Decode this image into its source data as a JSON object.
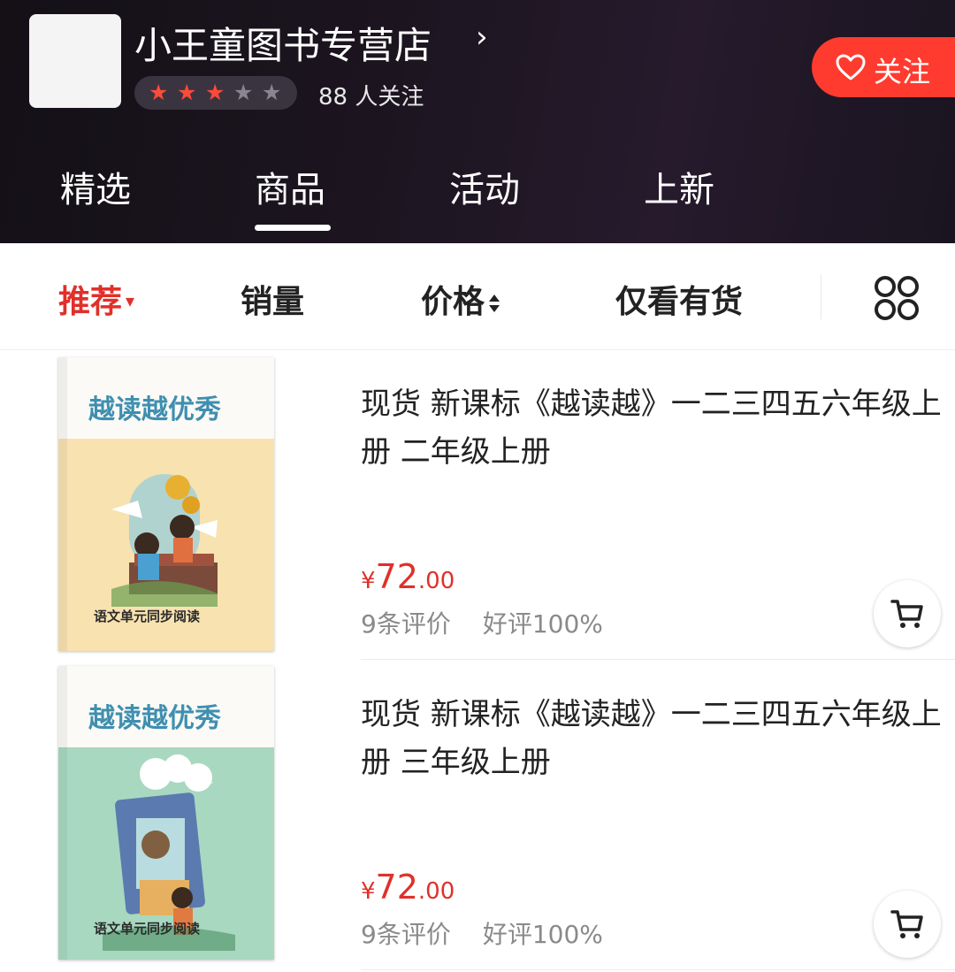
{
  "shop": {
    "name": "小王童图书专营店",
    "arrow": "›",
    "rating_stars_filled": 3,
    "rating_stars_total": 5,
    "followers": "88 人关注",
    "follow_label": "关注",
    "logo_icon": "shop-logo"
  },
  "tabs": [
    {
      "label": "精选",
      "active": false
    },
    {
      "label": "商品",
      "active": true
    },
    {
      "label": "活动",
      "active": false
    },
    {
      "label": "上新",
      "active": false
    }
  ],
  "sort": {
    "recommend": "推荐",
    "sales": "销量",
    "price": "价格",
    "in_stock": "仅看有货",
    "layout_icon": "grid-layout-icon"
  },
  "colors": {
    "accent": "#e0302a",
    "follow_button": "#ff3b2f",
    "star_filled": "#ff4a3a",
    "star_empty": "#8a8590",
    "header_bg": "#1c1520"
  },
  "products": [
    {
      "title": "现货 新课标《越读越》一二三四五六年级上册 二年级上册",
      "price_currency": "¥",
      "price_int": "72",
      "price_dec": ".00",
      "reviews": "9条评价",
      "positive": "好评100%",
      "cover_title": "越读越优秀",
      "cover_subtitle": "语文单元同步阅读",
      "cover_color": "#f7e2b0"
    },
    {
      "title": "现货 新课标《越读越》一二三四五六年级上册 三年级上册",
      "price_currency": "¥",
      "price_int": "72",
      "price_dec": ".00",
      "reviews": "9条评价",
      "positive": "好评100%",
      "cover_title": "越读越优秀",
      "cover_subtitle": "语文单元同步阅读",
      "cover_color": "#a8d8c0"
    }
  ]
}
